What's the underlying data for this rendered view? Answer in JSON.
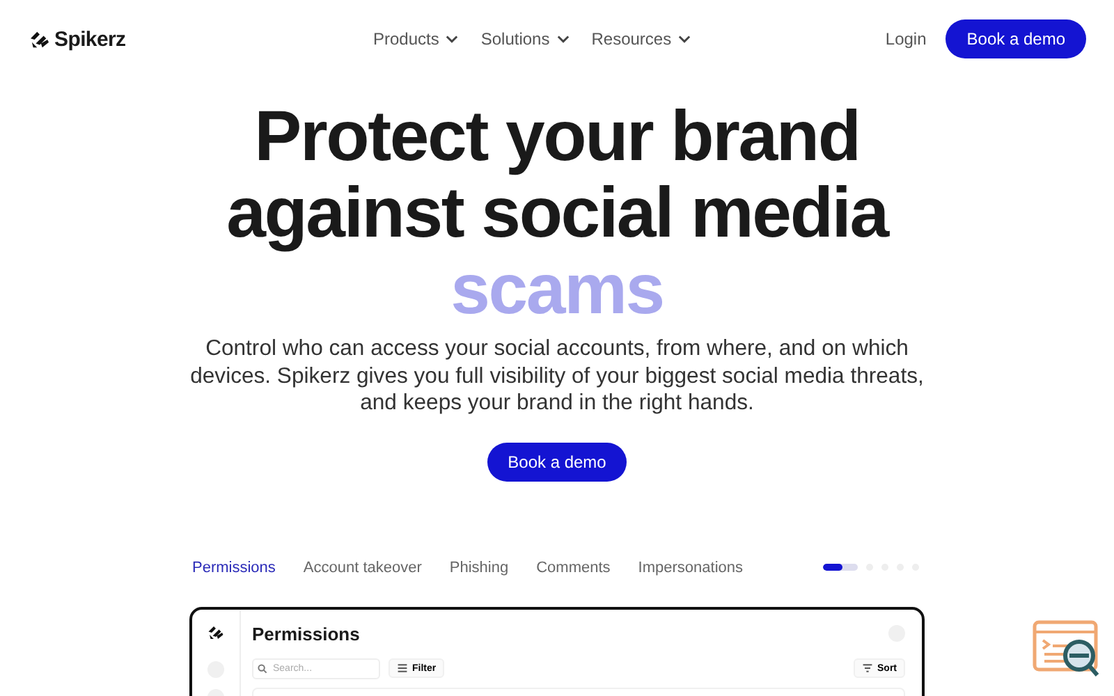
{
  "nav": {
    "logo": "Spikerz",
    "menu": [
      {
        "label": "Products"
      },
      {
        "label": "Solutions"
      },
      {
        "label": "Resources"
      }
    ],
    "login": "Login",
    "cta": "Book a demo"
  },
  "hero": {
    "title_lines": [
      "Protect your brand",
      "against social media"
    ],
    "highlight": "scams",
    "text": "Control who can access your social accounts, from where, and on which devices. Spikerz gives you full visibility of your biggest social media threats, and keeps your brand in the right hands.",
    "cta": "Book a demo"
  },
  "tabs": [
    {
      "label": "Permissions",
      "selected": true
    },
    {
      "label": "Account takeover",
      "selected": false
    },
    {
      "label": "Phishing",
      "selected": false
    },
    {
      "label": "Comments",
      "selected": false
    },
    {
      "label": "Impersonations",
      "selected": false
    }
  ],
  "carousel": {
    "level": 0.55
  },
  "preview": {
    "title": "Permissions",
    "search": {
      "placeholder": "Search..."
    },
    "filter": "Filter",
    "sort": "Sort"
  }
}
